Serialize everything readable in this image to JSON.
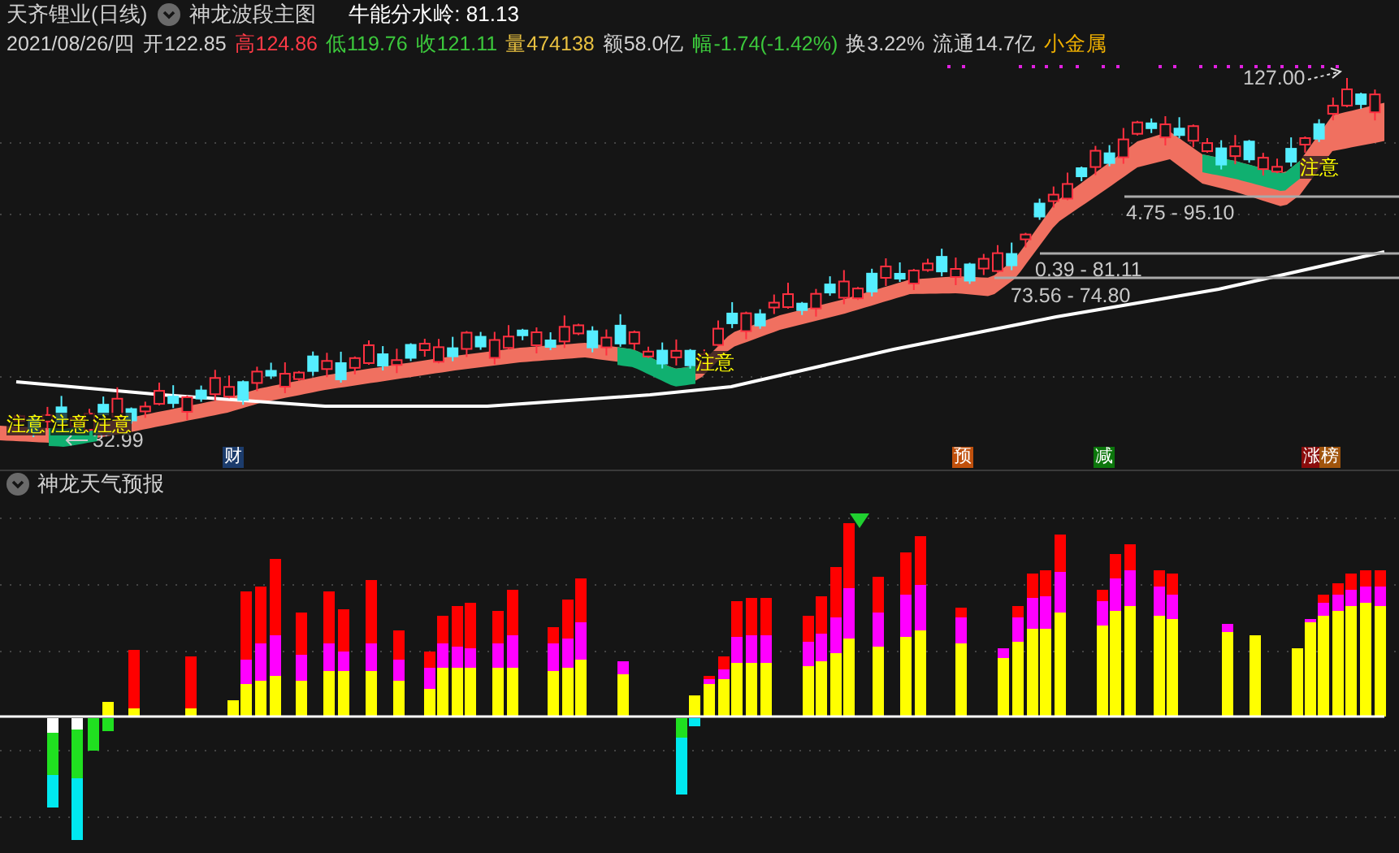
{
  "header": {
    "title": "天齐锂业(日线)",
    "indicator": "神龙波段主图",
    "threshold": "牛能分水岭: 81.13"
  },
  "quote": [
    {
      "text": "2021/08/26/四",
      "color": "#d2d2d2"
    },
    {
      "text": "开122.85",
      "color": "#d2d2d2"
    },
    {
      "text": "高124.86",
      "color": "#ff3a46"
    },
    {
      "text": "低119.76",
      "color": "#3cc83c"
    },
    {
      "text": "收121.11",
      "color": "#3cc83c"
    },
    {
      "text": "量474138",
      "color": "#e8c040"
    },
    {
      "text": "额58.0亿",
      "color": "#d2d2d2"
    },
    {
      "text": "幅-1.74(-1.42%)",
      "color": "#3cc83c"
    },
    {
      "text": "换3.22%",
      "color": "#d2d2d2"
    },
    {
      "text": "流通14.7亿",
      "color": "#d2d2d2"
    },
    {
      "text": "小金属",
      "color": "#f0b000"
    }
  ],
  "main_chart": {
    "price_labels": [
      {
        "text": "127.00"
      },
      {
        "text": "4.75 - 95.10"
      },
      {
        "text": "0.39 - 81.11"
      },
      {
        "text": "73.56 - 74.80"
      },
      {
        "text": "32.99"
      }
    ],
    "notes": [
      {
        "text": "注意"
      },
      {
        "text": "注意"
      },
      {
        "text": "注意"
      },
      {
        "text": "注意"
      },
      {
        "text": "注意"
      }
    ],
    "badges": [
      {
        "text": "财",
        "color": "#1c3c6c"
      },
      {
        "text": "预",
        "color": "#c0500c"
      },
      {
        "text": "减",
        "color": "#0c760c"
      },
      {
        "text": "涨",
        "color": "#8a0c0c"
      },
      {
        "text": "榜",
        "color": "#a0540c"
      }
    ]
  },
  "sub_panel": {
    "title": "神龙天气预报"
  }
}
